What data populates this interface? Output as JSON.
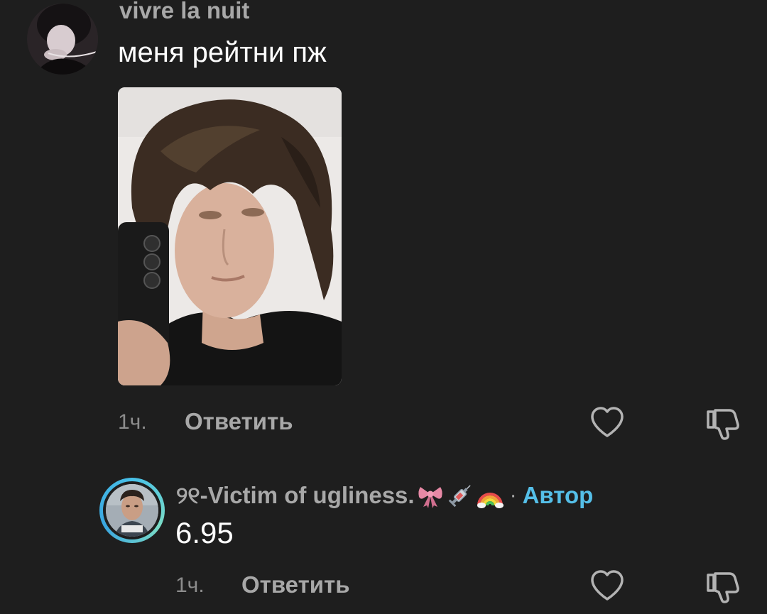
{
  "comments": [
    {
      "username": "vivre la nuit",
      "text": "меня рейтни пж",
      "time": "1ч.",
      "reply_label": "Ответить",
      "has_photo": true
    },
    {
      "username": "୨୧-Victim of ugliness.",
      "username_emojis": [
        "ribbon-emoji",
        "syringe-emoji",
        "rainbow-emoji"
      ],
      "separator": "·",
      "author_badge": "Автор",
      "text": "6.95",
      "time": "1ч.",
      "reply_label": "Ответить"
    }
  ],
  "icons": {
    "like": "heart-icon",
    "dislike": "thumbs-down-icon"
  },
  "colors": {
    "background": "#1e1e1e",
    "username": "#a8a8a8",
    "text": "#ffffff",
    "meta": "#8c8c8c",
    "author_badge": "#55bfe8",
    "ring": "#47c0e8"
  }
}
